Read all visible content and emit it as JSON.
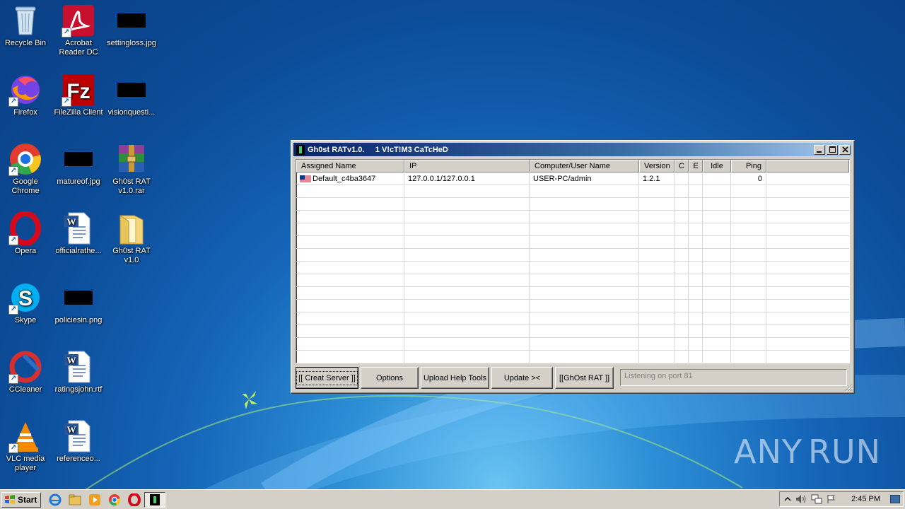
{
  "desktop": {
    "icons": [
      {
        "label": "Recycle Bin",
        "icon": "recycle-bin-icon"
      },
      {
        "label": "Acrobat Reader DC",
        "icon": "acrobat-icon"
      },
      {
        "label": "settingloss.jpg",
        "icon": "image-file-icon"
      },
      {
        "label": "Firefox",
        "icon": "firefox-icon"
      },
      {
        "label": "FileZilla Client",
        "icon": "filezilla-icon"
      },
      {
        "label": "visionquesti...",
        "icon": "image-file-icon"
      },
      {
        "label": "Google Chrome",
        "icon": "chrome-icon"
      },
      {
        "label": "matureof.jpg",
        "icon": "image-file-icon"
      },
      {
        "label": "Gh0st RAT v1.0.rar",
        "icon": "winrar-icon"
      },
      {
        "label": "Opera",
        "icon": "opera-icon"
      },
      {
        "label": "officialrathe...",
        "icon": "word-doc-icon"
      },
      {
        "label": "Gh0st RAT v1.0",
        "icon": "folder-icon"
      },
      {
        "label": "Skype",
        "icon": "skype-icon"
      },
      {
        "label": "policiesin.png",
        "icon": "image-file-icon"
      },
      {
        "label": "CCleaner",
        "icon": "ccleaner-icon"
      },
      {
        "label": "ratingsjohn.rtf",
        "icon": "word-doc-icon"
      },
      {
        "label": "VLC media player",
        "icon": "vlc-icon"
      },
      {
        "label": "referenceo...",
        "icon": "word-doc-icon"
      }
    ],
    "watermark": {
      "left": "ANY",
      "right": "RUN"
    }
  },
  "window": {
    "title": "Gh0st RATv1.0.     1 V!cT!M3 CaTcHeD",
    "columns": [
      "Assigned Name",
      "IP",
      "Computer/User Name",
      "Version",
      "C",
      "E",
      "Idle",
      "Ping"
    ],
    "rows": [
      {
        "name": "Default_c4ba3647",
        "ip": "127.0.0.1/127.0.0.1",
        "computer": "USER-PC/admin",
        "version": "1.2.1",
        "c": "",
        "e": "",
        "idle": "",
        "ping": "0"
      }
    ],
    "buttons": {
      "create_server": "[[ Creat Server ]]",
      "options": "Options",
      "upload_help_tools": "Upload Help Tools",
      "update": "Update ><",
      "ghost_rat": "[[GhOst RAT ]]"
    },
    "status": "Listening on port 81"
  },
  "taskbar": {
    "start_label": "Start",
    "clock": "2:45 PM"
  },
  "colors": {
    "title_bar": "#0a246a",
    "window_face": "#d4d0c8",
    "desktop": "#1565b8"
  }
}
